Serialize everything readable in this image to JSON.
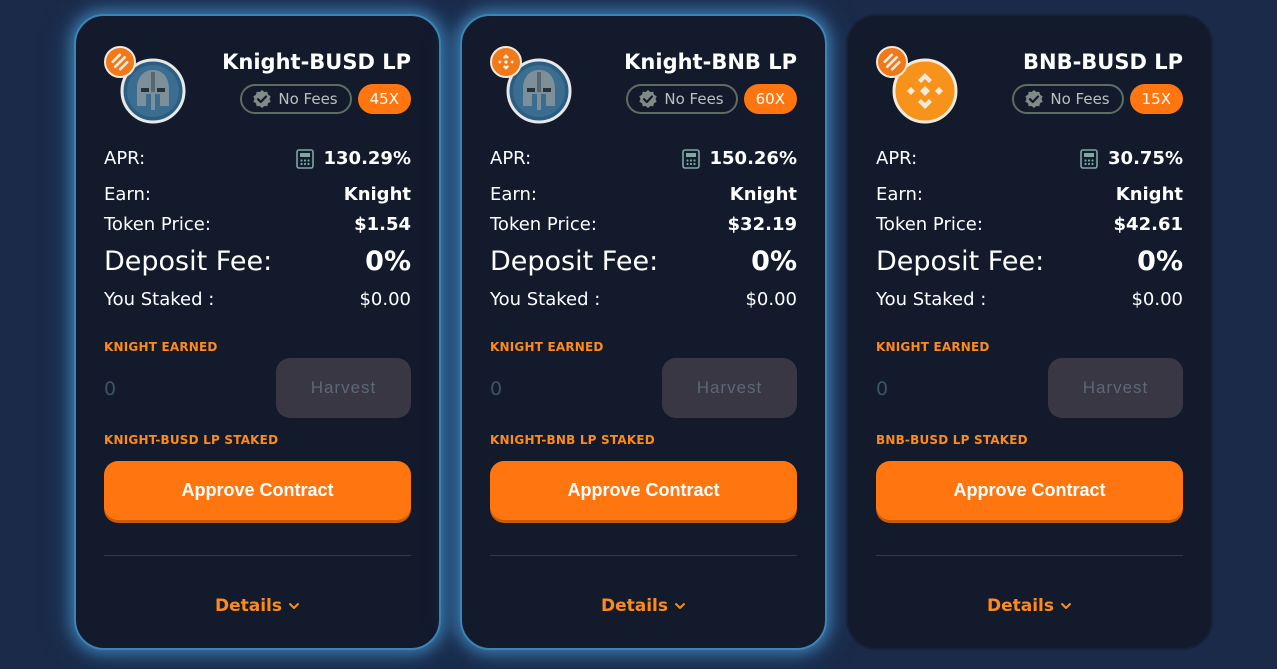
{
  "common": {
    "no_fees": "No Fees",
    "apr_label": "APR:",
    "earn_label": "Earn:",
    "token_price_label": "Token Price:",
    "deposit_fee_label": "Deposit Fee:",
    "you_staked_label": "You Staked :",
    "earned_label": "KNIGHT EARNED",
    "earned_amount": "0",
    "harvest_label": "Harvest",
    "approve_label": "Approve Contract",
    "details_label": "Details"
  },
  "colors": {
    "accent": "#ff7610",
    "card_bg": "#121a2c",
    "page_bg": "#1a2a48",
    "glow": "#3b84b5"
  },
  "cards": [
    {
      "name": "Knight-BUSD LP",
      "multiplier": "45X",
      "apr": "130.29%",
      "earn": "Knight",
      "token_price": "$1.54",
      "deposit_fee": "0%",
      "staked": "$0.00",
      "staked_label": "KNIGHT-BUSD LP STAKED",
      "logo_icon": "knight-helmet-icon",
      "chain_icon": "busd-icon"
    },
    {
      "name": "Knight-BNB LP",
      "multiplier": "60X",
      "apr": "150.26%",
      "earn": "Knight",
      "token_price": "$32.19",
      "deposit_fee": "0%",
      "staked": "$0.00",
      "staked_label": "KNIGHT-BNB LP STAKED",
      "logo_icon": "knight-helmet-icon",
      "chain_icon": "bnb-icon"
    },
    {
      "name": "BNB-BUSD LP",
      "multiplier": "15X",
      "apr": "30.75%",
      "earn": "Knight",
      "token_price": "$42.61",
      "deposit_fee": "0%",
      "staked": "$0.00",
      "staked_label": "BNB-BUSD LP STAKED",
      "logo_icon": "bnb-icon",
      "chain_icon": "busd-icon"
    }
  ]
}
